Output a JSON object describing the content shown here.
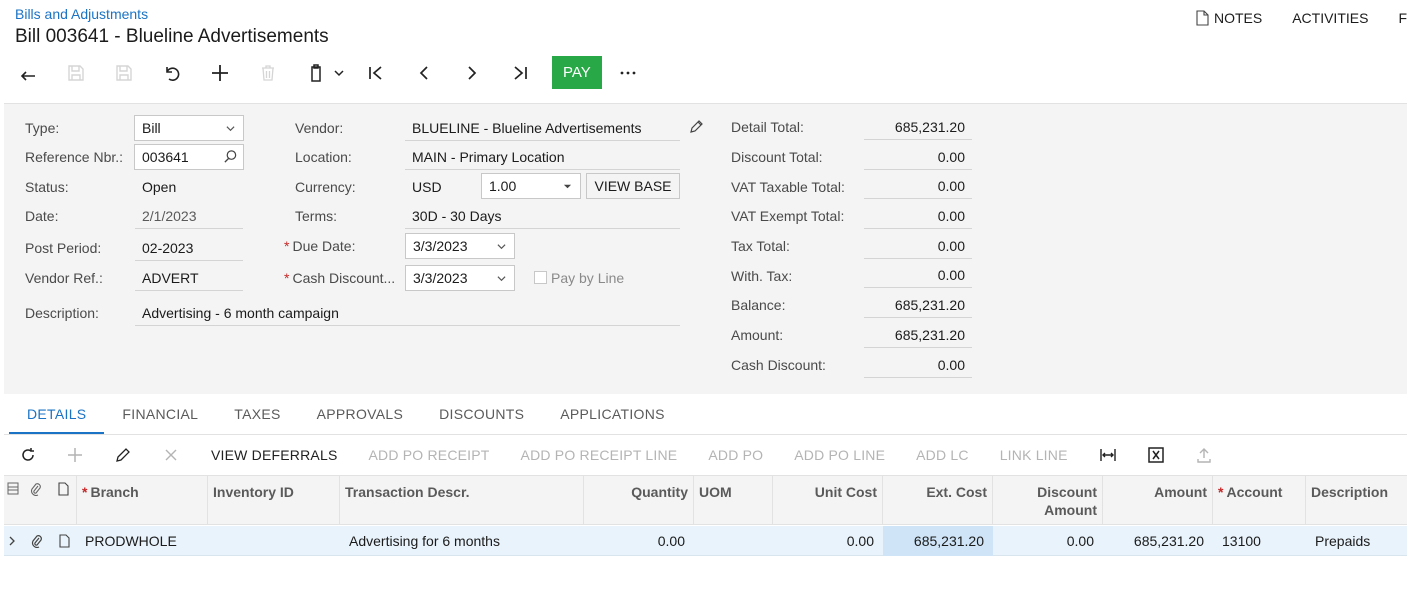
{
  "header": {
    "breadcrumb": "Bills and Adjustments",
    "title": "Bill 003641 - Blueline Advertisements",
    "links": {
      "notes": "NOTES",
      "activities": "ACTIVITIES",
      "files": "F"
    }
  },
  "toolbar": {
    "pay_label": "PAY"
  },
  "form": {
    "col1": {
      "type_label": "Type:",
      "type_value": "Bill",
      "ref_label": "Reference Nbr.:",
      "ref_value": "003641",
      "status_label": "Status:",
      "status_value": "Open",
      "date_label": "Date:",
      "date_value": "2/1/2023",
      "post_period_label": "Post Period:",
      "post_period_value": "02-2023",
      "vendor_ref_label": "Vendor Ref.:",
      "vendor_ref_value": "ADVERT",
      "description_label": "Description:",
      "description_value": "Advertising - 6 month campaign"
    },
    "col2": {
      "vendor_label": "Vendor:",
      "vendor_value": "BLUELINE - Blueline Advertisements",
      "location_label": "Location:",
      "location_value": "MAIN - Primary Location",
      "currency_label": "Currency:",
      "currency_value": "USD",
      "rate_value": "1.00",
      "view_base_label": "VIEW BASE",
      "terms_label": "Terms:",
      "terms_value": "30D - 30 Days",
      "due_date_label": "Due Date:",
      "due_date_value": "3/3/2023",
      "cash_discount_label": "Cash Discount...",
      "cash_discount_value": "3/3/2023",
      "pay_by_line_label": "Pay by Line"
    },
    "totals": [
      {
        "label": "Detail Total:",
        "value": "685,231.20"
      },
      {
        "label": "Discount Total:",
        "value": "0.00"
      },
      {
        "label": "VAT Taxable Total:",
        "value": "0.00"
      },
      {
        "label": "VAT Exempt Total:",
        "value": "0.00"
      },
      {
        "label": "Tax Total:",
        "value": "0.00"
      },
      {
        "label": "With. Tax:",
        "value": "0.00"
      },
      {
        "label": "Balance:",
        "value": "685,231.20"
      },
      {
        "label": "Amount:",
        "value": "685,231.20"
      },
      {
        "label": "Cash Discount:",
        "value": "0.00"
      }
    ]
  },
  "tabs": [
    "DETAILS",
    "FINANCIAL",
    "TAXES",
    "APPROVALS",
    "DISCOUNTS",
    "APPLICATIONS"
  ],
  "grid_toolbar": {
    "view_deferrals": "VIEW DEFERRALS",
    "add_po_receipt": "ADD PO RECEIPT",
    "add_po_receipt_line": "ADD PO RECEIPT LINE",
    "add_po": "ADD PO",
    "add_po_line": "ADD PO LINE",
    "add_lc": "ADD LC",
    "link_line": "LINK LINE"
  },
  "grid": {
    "columns": {
      "branch": "Branch",
      "inventory_id": "Inventory ID",
      "tran_descr": "Transaction Descr.",
      "quantity": "Quantity",
      "uom": "UOM",
      "unit_cost": "Unit Cost",
      "ext_cost": "Ext. Cost",
      "discount_amount_1": "Discount",
      "discount_amount_2": "Amount",
      "amount": "Amount",
      "account": "Account",
      "description": "Description"
    },
    "rows": [
      {
        "branch": "PRODWHOLE",
        "inventory_id": "",
        "tran_descr": "Advertising for 6 months",
        "quantity": "0.00",
        "uom": "",
        "unit_cost": "0.00",
        "ext_cost": "685,231.20",
        "discount_amount": "0.00",
        "amount": "685,231.20",
        "account": "13100",
        "description": "Prepaids"
      }
    ]
  },
  "colors": {
    "accent": "#1a73c4",
    "pay": "#29a847",
    "required": "#c62828"
  }
}
